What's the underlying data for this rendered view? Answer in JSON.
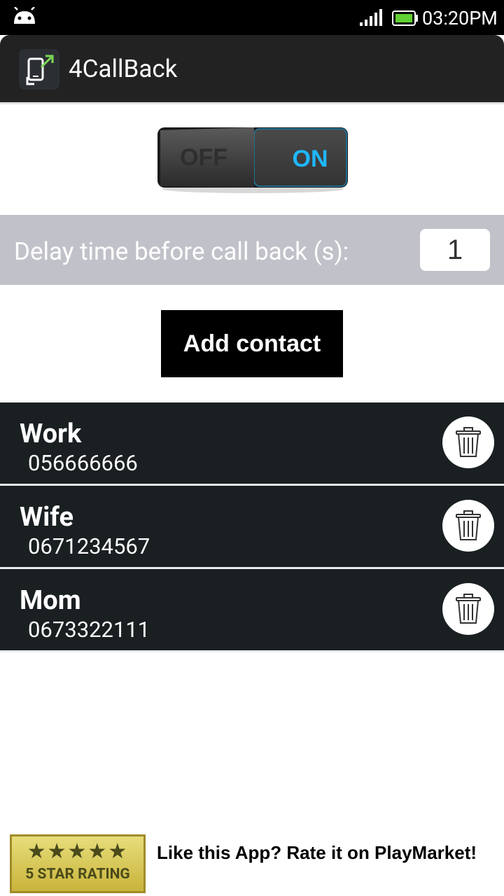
{
  "status_bar": {
    "time": "03:20PM"
  },
  "app_bar": {
    "title": "4CallBack"
  },
  "toggle": {
    "off_label": "OFF",
    "on_label": "ON",
    "state": "on"
  },
  "delay": {
    "label": "Delay time before call back (s):",
    "value": "1"
  },
  "add_contact": {
    "label": "Add contact"
  },
  "contacts": [
    {
      "name": "Work",
      "phone": "056666666"
    },
    {
      "name": "Wife",
      "phone": "0671234567"
    },
    {
      "name": "Mom",
      "phone": "0673322111"
    }
  ],
  "rating": {
    "stars": "★★★★★",
    "badge_text": "5 STAR RATING",
    "message": "Like this App? Rate it on PlayMarket!"
  },
  "colors": {
    "action_bar": "#222222",
    "delay_bar": "#c1c2c9",
    "contact_row": "#1a1f22",
    "toggle_on": "#1fb7ff"
  }
}
